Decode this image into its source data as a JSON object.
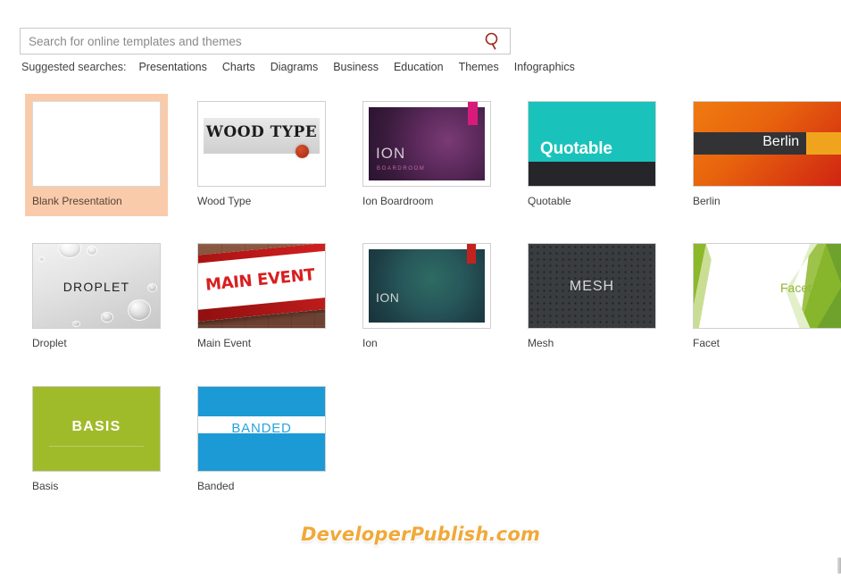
{
  "search": {
    "placeholder": "Search for online templates and themes",
    "value": "",
    "icon": "search-icon"
  },
  "suggested": {
    "label": "Suggested searches:",
    "items": [
      "Presentations",
      "Charts",
      "Diagrams",
      "Business",
      "Education",
      "Themes",
      "Infographics"
    ]
  },
  "templates": [
    {
      "name": "Blank Presentation",
      "selected": true,
      "art": "blank",
      "title": ""
    },
    {
      "name": "Wood Type",
      "selected": false,
      "art": "wood",
      "title": "WOOD TYPE"
    },
    {
      "name": "Ion Boardroom",
      "selected": false,
      "art": "ionb",
      "title": "ION",
      "subtitle": "BOARDROOM"
    },
    {
      "name": "Quotable",
      "selected": false,
      "art": "quote",
      "title": "Quotable"
    },
    {
      "name": "Berlin",
      "selected": false,
      "art": "berlin",
      "title": "Berlin"
    },
    {
      "name": "Droplet",
      "selected": false,
      "art": "droplet",
      "title": "DROPLET"
    },
    {
      "name": "Main Event",
      "selected": false,
      "art": "main",
      "title": "MAIN EVENT"
    },
    {
      "name": "Ion",
      "selected": false,
      "art": "ion",
      "title": "ION"
    },
    {
      "name": "Mesh",
      "selected": false,
      "art": "mesh",
      "title": "MESH"
    },
    {
      "name": "Facet",
      "selected": false,
      "art": "facet",
      "title": "Facet"
    },
    {
      "name": "Basis",
      "selected": false,
      "art": "basis",
      "title": "BASIS"
    },
    {
      "name": "Banded",
      "selected": false,
      "art": "banded",
      "title": "BANDED"
    }
  ],
  "watermark": "DeveloperPublish.com",
  "colors": {
    "selection": "#f9cbab",
    "search_icon": "#9c2b1b",
    "quotable_teal": "#19c3bb",
    "berlin_orange": "#ef7b10",
    "berlin_amber": "#f0a41e",
    "ion_teal": "#27575a",
    "ion_tab_red": "#c3231f",
    "ionboardroom_purple": "#5c2a5c",
    "ionboardroom_tab_pink": "#d81b7a",
    "mesh_charcoal": "#3a3d40",
    "facet_green": "#8fb536",
    "basis_olive": "#a0bb2a",
    "banded_blue": "#1b9ad6",
    "main_event_red": "#d81f20",
    "watermark_orange": "#f0a93a"
  }
}
